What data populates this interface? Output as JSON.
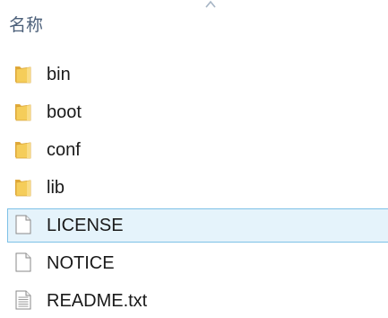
{
  "column_header": {
    "label": "名称",
    "sort_indicator": "sort-ascending-icon"
  },
  "files": [
    {
      "name": "bin",
      "type": "folder",
      "icon": "folder-icon"
    },
    {
      "name": "boot",
      "type": "folder",
      "icon": "folder-icon"
    },
    {
      "name": "conf",
      "type": "folder",
      "icon": "folder-icon"
    },
    {
      "name": "lib",
      "type": "folder",
      "icon": "folder-icon"
    },
    {
      "name": "LICENSE",
      "type": "file",
      "icon": "file-icon",
      "selected": true
    },
    {
      "name": "NOTICE",
      "type": "file",
      "icon": "file-icon"
    },
    {
      "name": "README.txt",
      "type": "text-file",
      "icon": "text-file-icon"
    }
  ],
  "colors": {
    "selection_background": "#e5f3fb",
    "selection_border": "#7ec1e7",
    "header_text": "#4c607a",
    "folder_yellow": "#f5cd5a"
  }
}
